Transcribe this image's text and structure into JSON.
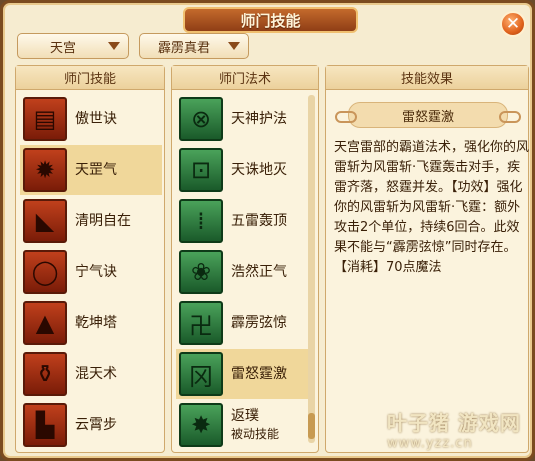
{
  "window": {
    "title": "师门技能",
    "close_symbol": "✕"
  },
  "dropdowns": {
    "sect": "天宫",
    "master": "霹雳真君"
  },
  "panels": {
    "skills_header": "师门技能",
    "spells_header": "师门法术",
    "effect_header": "技能效果"
  },
  "skills": [
    {
      "name": "傲世诀",
      "icon": "scroll-icon",
      "glyph": "▤"
    },
    {
      "name": "天罡气",
      "icon": "warrior-icon",
      "glyph": "✹"
    },
    {
      "name": "清明自在",
      "icon": "horn-icon",
      "glyph": "◣"
    },
    {
      "name": "宁气诀",
      "icon": "ring-icon",
      "glyph": "◯"
    },
    {
      "name": "乾坤塔",
      "icon": "pagoda-icon",
      "glyph": "▲"
    },
    {
      "name": "混天术",
      "icon": "cauldron-icon",
      "glyph": "⚱"
    },
    {
      "name": "云霄步",
      "icon": "boot-icon",
      "glyph": "▙"
    }
  ],
  "selected_skill": "天罡气",
  "spells": [
    {
      "name": "天神护法",
      "icon": "bow-icon",
      "glyph": "⊗",
      "sub": ""
    },
    {
      "name": "天诛地灭",
      "icon": "frame-icon",
      "glyph": "⊡",
      "sub": ""
    },
    {
      "name": "五雷轰顶",
      "icon": "chains-icon",
      "glyph": "⁞",
      "sub": ""
    },
    {
      "name": "浩然正气",
      "icon": "cloud-icon",
      "glyph": "❀",
      "sub": ""
    },
    {
      "name": "霹雳弦惊",
      "icon": "rune-icon",
      "glyph": "卍",
      "sub": ""
    },
    {
      "name": "雷怒霆激",
      "icon": "glyph-icon",
      "glyph": "冈",
      "sub": ""
    },
    {
      "name": "返璞",
      "icon": "burst-icon",
      "glyph": "✸",
      "sub": "被动技能"
    }
  ],
  "selected_spell": "雷怒霆激",
  "effect": {
    "title": "雷怒霆激",
    "text": "天宫雷部的霸道法术，强化你的风雷斩为风雷斩·飞霆轰击对手，疾雷齐落，怒霆并发。【功效】强化你的风雷斩为风雷斩·飞霆：额外攻击2个单位，持续6回合。此效果不能与“霹雳弦惊”同时存在。\n【消耗】70点魔法"
  },
  "watermark": {
    "top": "叶子猪 游戏网",
    "bottom": "www.yzz.cn"
  }
}
